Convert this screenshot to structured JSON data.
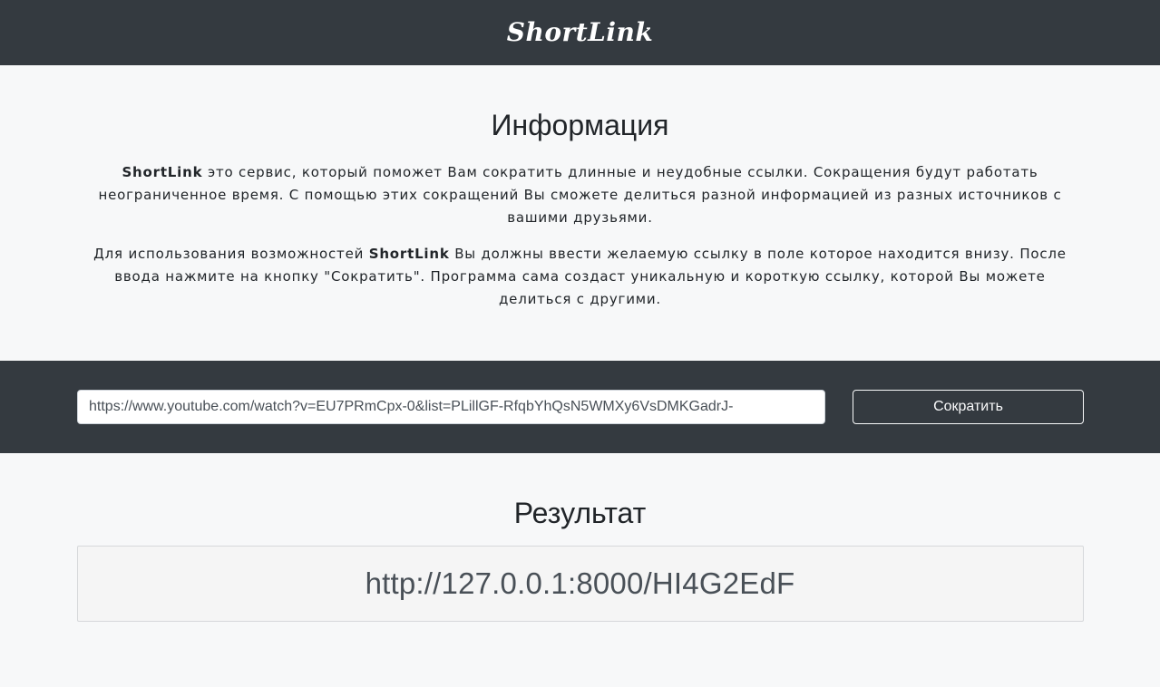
{
  "header": {
    "brand": "ShortLink"
  },
  "info": {
    "title": "Информация",
    "p1_brand": "ShortLink",
    "p1_text": " это сервис, который поможет Вам сократить длинные и неудобные ссылки. Сокращения будут работать неограниченное время. С помощью этих сокращений Вы сможете делиться разной информацией из разных источников с вашими друзьями.",
    "p2_before": "Для использования возможностей ",
    "p2_brand": "ShortLink",
    "p2_after": " Вы должны ввести желаемую ссылку в поле которое находится внизу. После ввода нажмите на кнопку \"Сократить\". Программа сама создаст уникальную и короткую ссылку, которой Вы можете делиться с другими."
  },
  "form": {
    "url_value": "https://www.youtube.com/watch?v=EU7PRmCpx-0&list=PLillGF-RfqbYhQsN5WMXy6VsDMKGadrJ-",
    "button_label": "Сократить"
  },
  "result": {
    "title": "Результат",
    "short_link": "http://127.0.0.1:8000/HI4G2EdF"
  },
  "colors": {
    "dark_bar": "#343a40",
    "page_bg": "#f7f8f9",
    "result_bg": "#f5f5f5"
  }
}
